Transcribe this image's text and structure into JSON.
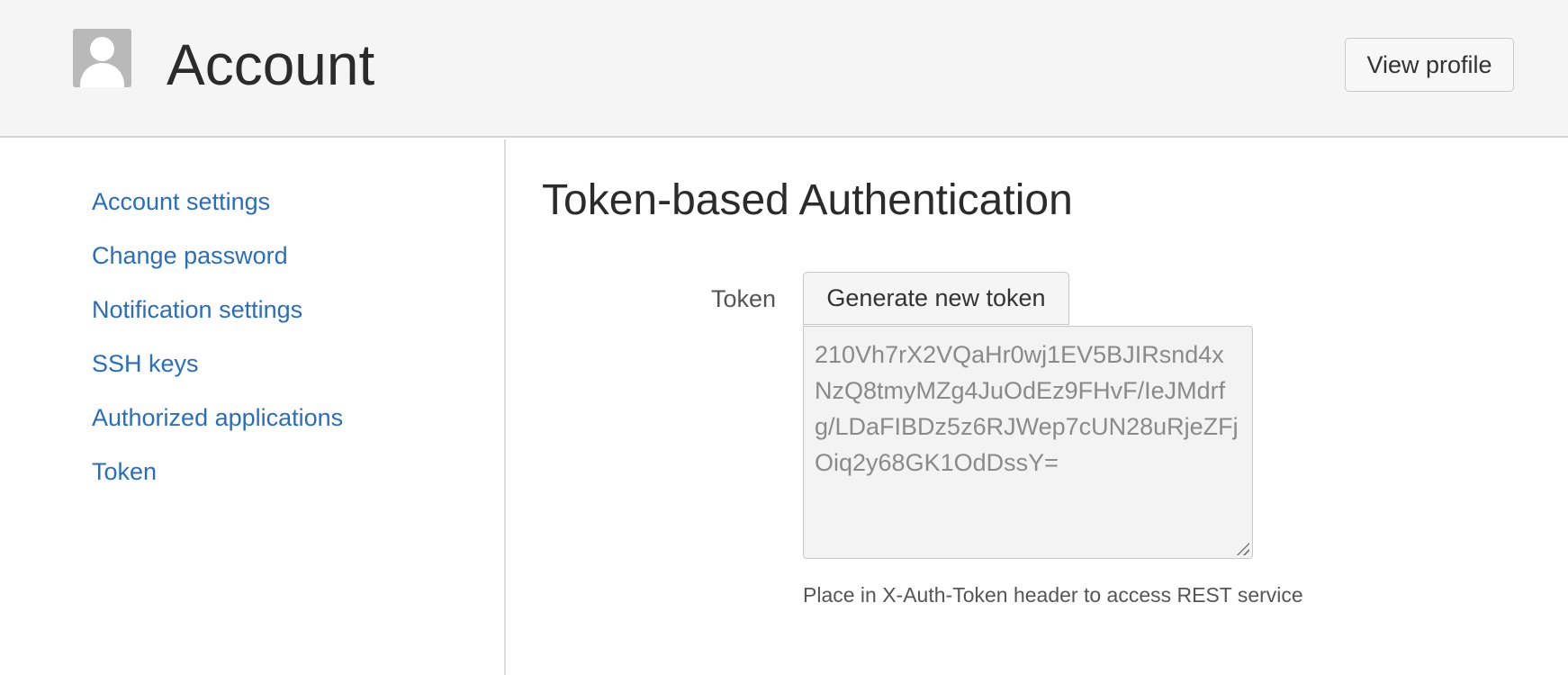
{
  "header": {
    "title": "Account",
    "avatar_icon": "user-silhouette-icon",
    "view_profile_label": "View profile"
  },
  "sidebar": {
    "items": [
      {
        "label": "Account settings"
      },
      {
        "label": "Change password"
      },
      {
        "label": "Notification settings"
      },
      {
        "label": "SSH keys"
      },
      {
        "label": "Authorized applications"
      },
      {
        "label": "Token"
      }
    ]
  },
  "main": {
    "title": "Token-based Authentication",
    "token_label": "Token",
    "generate_button_label": "Generate new token",
    "token_value": "210Vh7rX2VQaHr0wj1EV5BJIRsnd4xNzQ8tmyMZg4JuOdEz9FHvF/IeJMdrfg/LDaFIBDz5z6RJWep7cUN28uRjeZFjOiq2y68GK1OdDssY=",
    "help_text": "Place in X-Auth-Token header to access REST service"
  },
  "colors": {
    "link": "#2a6ebb",
    "header_bg": "#f5f5f5",
    "textarea_bg": "#f3f3f3"
  }
}
